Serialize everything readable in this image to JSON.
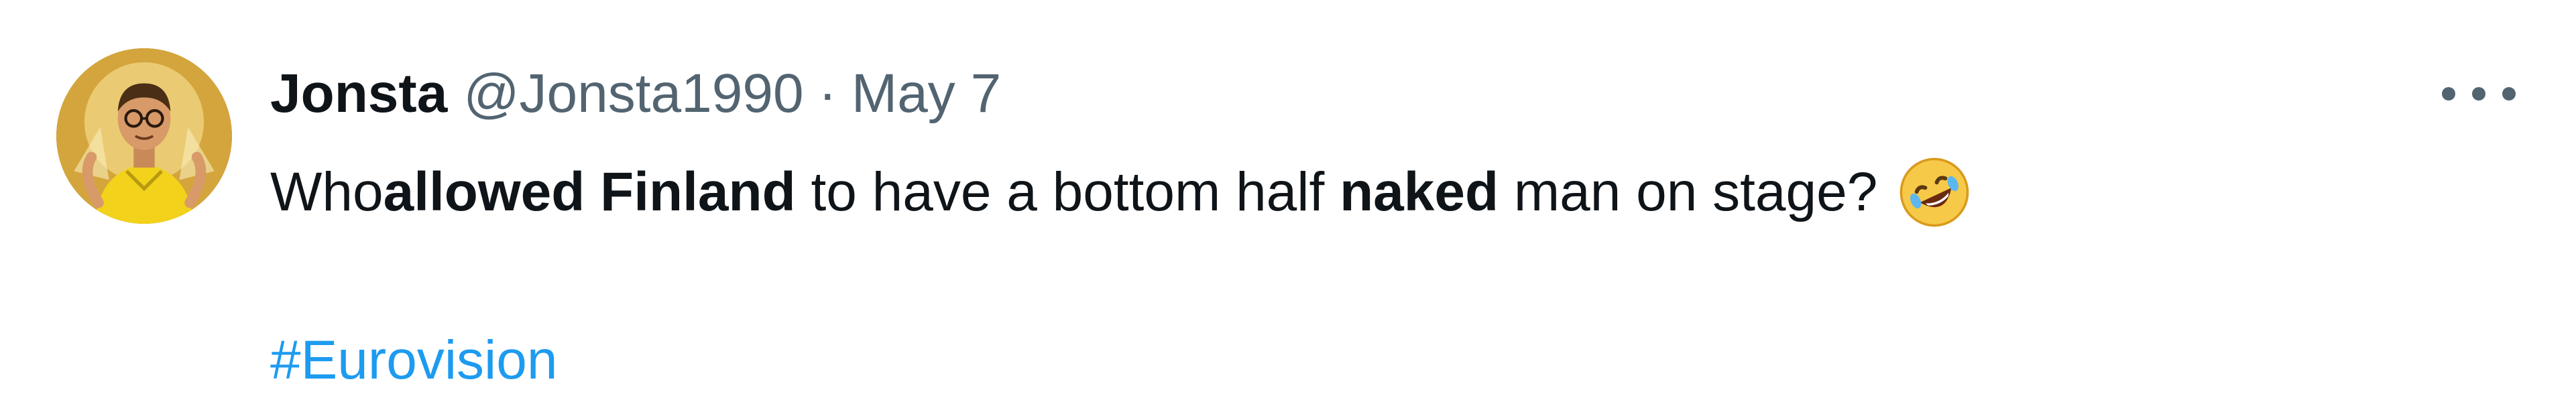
{
  "tweet": {
    "author": {
      "display_name": "Jonsta",
      "handle": "@Jonsta1990",
      "avatar_icon": "user-avatar-icon"
    },
    "separator": "·",
    "date": "May 7",
    "more_icon": "more-options-icon",
    "text_segments": [
      {
        "text": "Who ",
        "bold": false
      },
      {
        "text": "allowed",
        "bold": true
      },
      {
        "text": " ",
        "bold": false
      },
      {
        "text": "Finland",
        "bold": true
      },
      {
        "text": " to have a bottom half ",
        "bold": false
      },
      {
        "text": "naked",
        "bold": true
      },
      {
        "text": " man on stage?",
        "bold": false
      }
    ],
    "emoji_icon": "rolling-on-floor-laughing-emoji-icon",
    "hashtag": "#Eurovision"
  },
  "colors": {
    "text": "#0f1419",
    "secondary": "#536471",
    "link": "#1d9bf0"
  }
}
